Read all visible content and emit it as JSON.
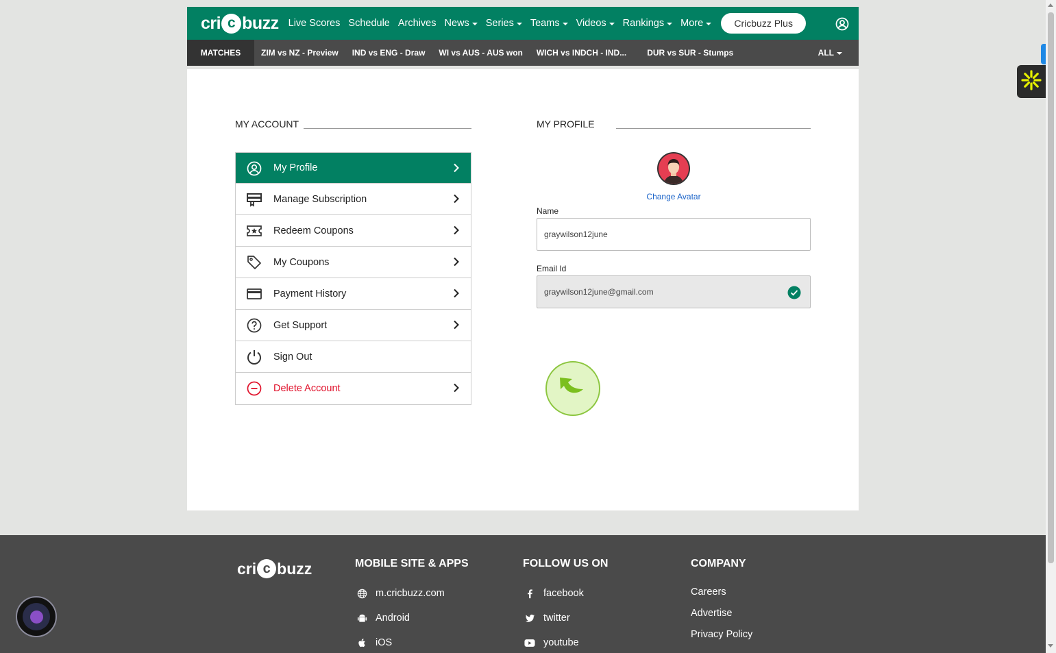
{
  "brand": {
    "logo_pre": "cri",
    "logo_ball": "c",
    "logo_post": "buzz",
    "accent": "#028062"
  },
  "nav": {
    "items": [
      {
        "label": "Live Scores",
        "dropdown": false
      },
      {
        "label": "Schedule",
        "dropdown": false
      },
      {
        "label": "Archives",
        "dropdown": false
      },
      {
        "label": "News",
        "dropdown": true
      },
      {
        "label": "Series",
        "dropdown": true
      },
      {
        "label": "Teams",
        "dropdown": true
      },
      {
        "label": "Videos",
        "dropdown": true
      },
      {
        "label": "Rankings",
        "dropdown": true
      },
      {
        "label": "More",
        "dropdown": true
      }
    ],
    "plus_label": "Cricbuzz Plus",
    "user_icon": "user-circle-icon"
  },
  "matches": {
    "label": "MATCHES",
    "items": [
      "ZIM vs NZ - Preview",
      "IND vs ENG - Draw",
      "WI vs AUS - AUS won",
      "WICH vs INDCH - IND...",
      "DUR vs SUR - Stumps"
    ],
    "all_label": "ALL"
  },
  "account": {
    "title": "MY ACCOUNT",
    "menu": [
      {
        "label": "My Profile",
        "icon": "user-circle-icon",
        "active": true,
        "chevron": true
      },
      {
        "label": "Manage Subscription",
        "icon": "subscription-icon",
        "active": false,
        "chevron": true
      },
      {
        "label": "Redeem Coupons",
        "icon": "ticket-star-icon",
        "active": false,
        "chevron": true
      },
      {
        "label": "My Coupons",
        "icon": "tag-icon",
        "active": false,
        "chevron": true
      },
      {
        "label": "Payment History",
        "icon": "credit-card-icon",
        "active": false,
        "chevron": true
      },
      {
        "label": "Get Support",
        "icon": "question-circle-icon",
        "active": false,
        "chevron": true
      },
      {
        "label": "Sign Out",
        "icon": "power-icon",
        "active": false,
        "chevron": false
      },
      {
        "label": "Delete Account",
        "icon": "minus-circle-icon",
        "active": false,
        "chevron": true,
        "danger": true
      }
    ]
  },
  "profile": {
    "title": "MY PROFILE",
    "change_avatar": "Change Avatar",
    "name_label": "Name",
    "name_value": "graywilson12june",
    "email_label": "Email Id",
    "email_value": "graywilson12june@gmail.com"
  },
  "footer": {
    "logo_pre": "cri",
    "logo_ball": "c",
    "logo_post": "buzz",
    "col1": {
      "title": "MOBILE SITE & APPS",
      "links": [
        {
          "label": "m.cricbuzz.com",
          "icon": "globe-icon"
        },
        {
          "label": "Android",
          "icon": "android-icon"
        },
        {
          "label": "iOS",
          "icon": "apple-icon"
        }
      ]
    },
    "col2": {
      "title": "FOLLOW US ON",
      "links": [
        {
          "label": "facebook",
          "icon": "facebook-icon"
        },
        {
          "label": "twitter",
          "icon": "twitter-icon"
        },
        {
          "label": "youtube",
          "icon": "youtube-icon"
        }
      ]
    },
    "col3": {
      "title": "COMPANY",
      "links": [
        {
          "label": "Careers"
        },
        {
          "label": "Advertise"
        },
        {
          "label": "Privacy Policy"
        }
      ]
    }
  }
}
